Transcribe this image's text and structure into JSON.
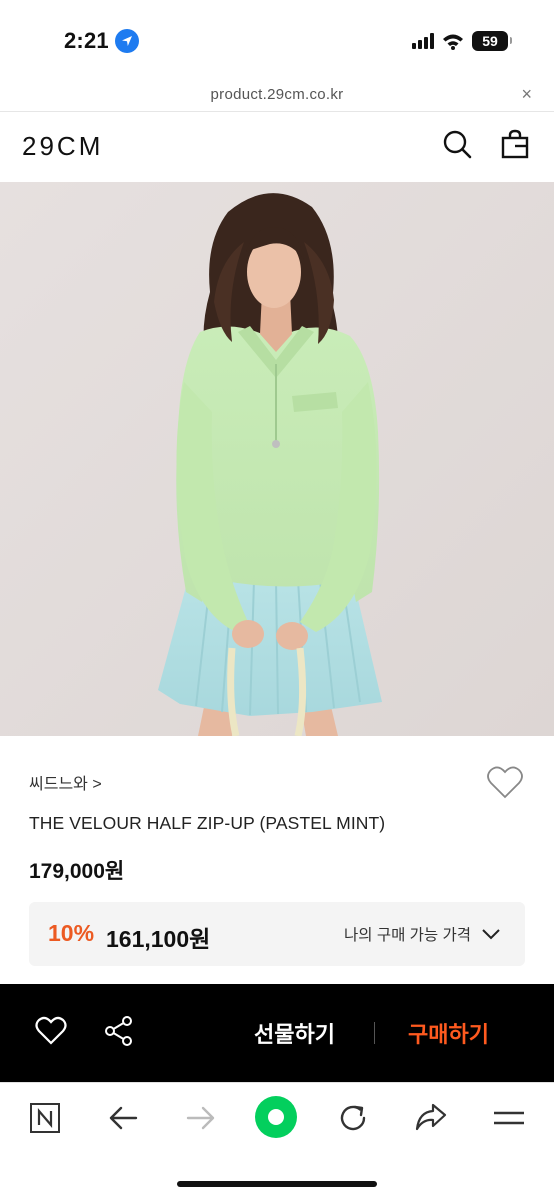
{
  "status_bar": {
    "time": "2:21",
    "battery": "59"
  },
  "url_bar": {
    "url": "product.29cm.co.kr",
    "close": "×"
  },
  "header": {
    "logo": "29CM"
  },
  "product": {
    "brand": "씨드느와 >",
    "name": "THE VELOUR HALF ZIP-UP  (PASTEL MINT)",
    "price": "179,000원",
    "discount_rate": "10%",
    "discount_price": "161,100원",
    "discount_label": "나의 구매 가능 가격"
  },
  "buy_bar": {
    "gift_label": "선물하기",
    "buy_label": "구매하기"
  },
  "colors": {
    "accent": "#ff5a1f",
    "discount": "#ec5a22",
    "toolbar_green": "#03cf5d"
  },
  "icons": [
    "location-arrow-icon",
    "signal-icon",
    "wifi-icon",
    "battery-icon",
    "close-icon",
    "search-icon",
    "shopping-bag-icon",
    "heart-icon",
    "chevron-down-icon",
    "share-icon",
    "naver-n-icon",
    "back-arrow-icon",
    "forward-arrow-icon",
    "naver-green-dot-icon",
    "reload-icon",
    "share-arrow-icon",
    "menu-icon"
  ]
}
